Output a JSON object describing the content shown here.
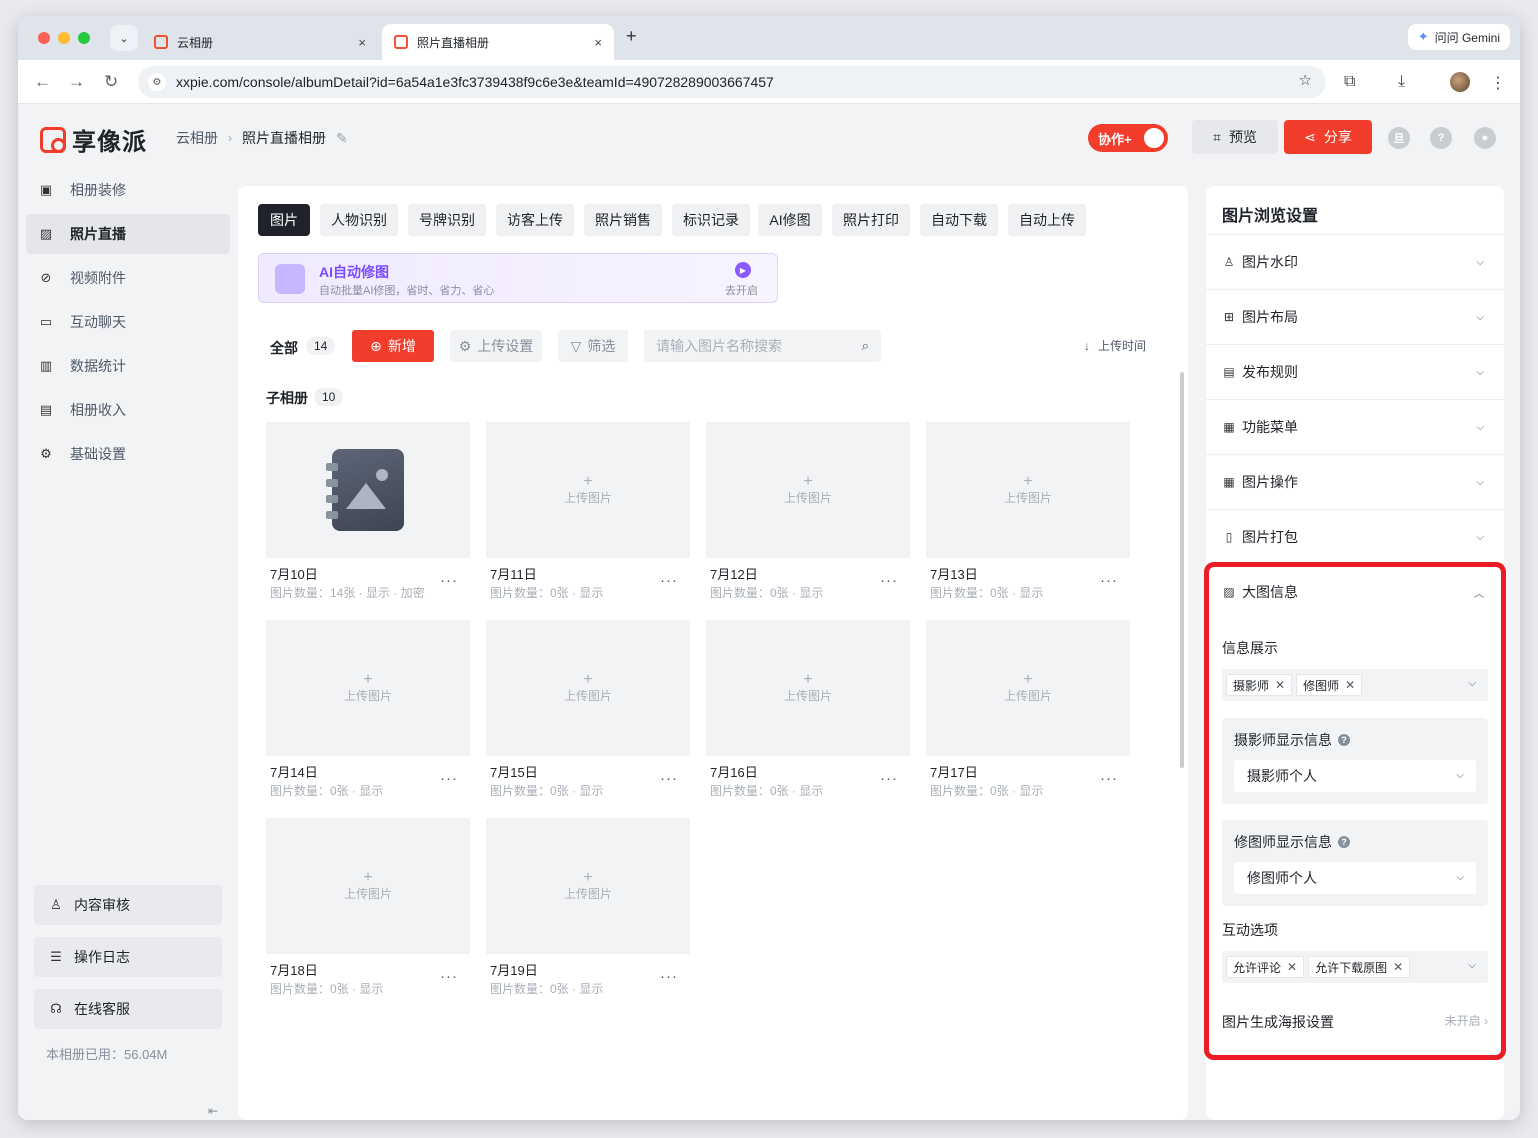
{
  "browser": {
    "tabs": [
      {
        "title": "云相册",
        "close": "×"
      },
      {
        "title": "照片直播相册",
        "close": "×"
      }
    ],
    "new_tab": "+",
    "dropdown": "⌄",
    "url": "xxpie.com/console/albumDetail?id=6a54a1e3fc3739438f9c6e3e&teamId=490728289003667457",
    "gemini_label": "问问 Gemini",
    "icons": [
      "back-icon",
      "forward-icon",
      "reload-icon",
      "site-info-icon",
      "bookmark-star-icon",
      "extensions-icon",
      "download-icon",
      "menu-icon"
    ]
  },
  "header": {
    "logo_text": "享像派",
    "breadcrumb": {
      "root": "云相册",
      "current": "照片直播相册"
    },
    "collab_label": "协作+",
    "preview_label": "预览",
    "share_label": "分享",
    "avatar_initial": "旦",
    "help_glyph": "?"
  },
  "sidebar": {
    "items": [
      {
        "label": "相册装修",
        "icon": "decor-icon"
      },
      {
        "label": "照片直播",
        "icon": "photo-live-icon"
      },
      {
        "label": "视频附件",
        "icon": "attachment-icon"
      },
      {
        "label": "互动聊天",
        "icon": "chat-icon"
      },
      {
        "label": "数据统计",
        "icon": "stats-icon"
      },
      {
        "label": "相册收入",
        "icon": "income-icon"
      },
      {
        "label": "基础设置",
        "icon": "settings-icon"
      }
    ],
    "bottom": [
      {
        "label": "内容审核",
        "icon": "review-icon"
      },
      {
        "label": "操作日志",
        "icon": "log-icon"
      },
      {
        "label": "在线客服",
        "icon": "support-icon"
      }
    ],
    "storage_text": "本相册已用：56.04M"
  },
  "main": {
    "tabs": [
      "图片",
      "人物识别",
      "号牌识别",
      "访客上传",
      "照片销售",
      "标识记录",
      "AI修图",
      "照片打印",
      "自动下载",
      "自动上传"
    ],
    "ai_banner": {
      "title": "AI自动修图",
      "subtitle": "自动批量AI修图，省时、省力、省心",
      "action": "去开启"
    },
    "toolbar": {
      "all_label": "全部",
      "all_count": "14",
      "add_label": "新增",
      "upload_settings_label": "上传设置",
      "filter_label": "筛选",
      "search_placeholder": "请输入图片名称搜索",
      "sort_label": "上传时间"
    },
    "sub_albums_label": "子相册",
    "sub_albums_count": "10",
    "upload_placeholder": "上传图片",
    "albums": [
      {
        "date": "7月10日",
        "meta": "图片数量：14张 · 显示 · 加密",
        "has_cover": true
      },
      {
        "date": "7月11日",
        "meta": "图片数量：0张 · 显示",
        "has_cover": false
      },
      {
        "date": "7月12日",
        "meta": "图片数量：0张 · 显示",
        "has_cover": false
      },
      {
        "date": "7月13日",
        "meta": "图片数量：0张 · 显示",
        "has_cover": false
      },
      {
        "date": "7月14日",
        "meta": "图片数量：0张 · 显示",
        "has_cover": false
      },
      {
        "date": "7月15日",
        "meta": "图片数量：0张 · 显示",
        "has_cover": false
      },
      {
        "date": "7月16日",
        "meta": "图片数量：0张 · 显示",
        "has_cover": false
      },
      {
        "date": "7月17日",
        "meta": "图片数量：0张 · 显示",
        "has_cover": false
      },
      {
        "date": "7月18日",
        "meta": "图片数量：0张 · 显示",
        "has_cover": false
      },
      {
        "date": "7月19日",
        "meta": "图片数量：0张 · 显示",
        "has_cover": false
      }
    ],
    "more_glyph": "···"
  },
  "settings": {
    "title": "图片浏览设置",
    "items": [
      {
        "label": "图片水印",
        "icon": "user-icon"
      },
      {
        "label": "图片布局",
        "icon": "layout-icon"
      },
      {
        "label": "发布规则",
        "icon": "rules-icon"
      },
      {
        "label": "功能菜单",
        "icon": "menu-grid-icon"
      },
      {
        "label": "图片操作",
        "icon": "grid-icon"
      },
      {
        "label": "图片打包",
        "icon": "package-icon"
      }
    ],
    "big_info": {
      "label": "大图信息",
      "info_display_label": "信息展示",
      "info_tags": [
        "摄影师",
        "修图师"
      ],
      "photographer_label": "摄影师显示信息",
      "photographer_value": "摄影师个人",
      "retoucher_label": "修图师显示信息",
      "retoucher_value": "修图师个人",
      "interaction_label": "互动选项",
      "interaction_tags": [
        "允许评论",
        "允许下载原图"
      ],
      "poster_label": "图片生成海报设置",
      "poster_status": "未开启"
    }
  },
  "colors": {
    "brand_red": "#f23d2c",
    "highlight": "#ec1c24",
    "ai_purple": "#7a4dff"
  }
}
